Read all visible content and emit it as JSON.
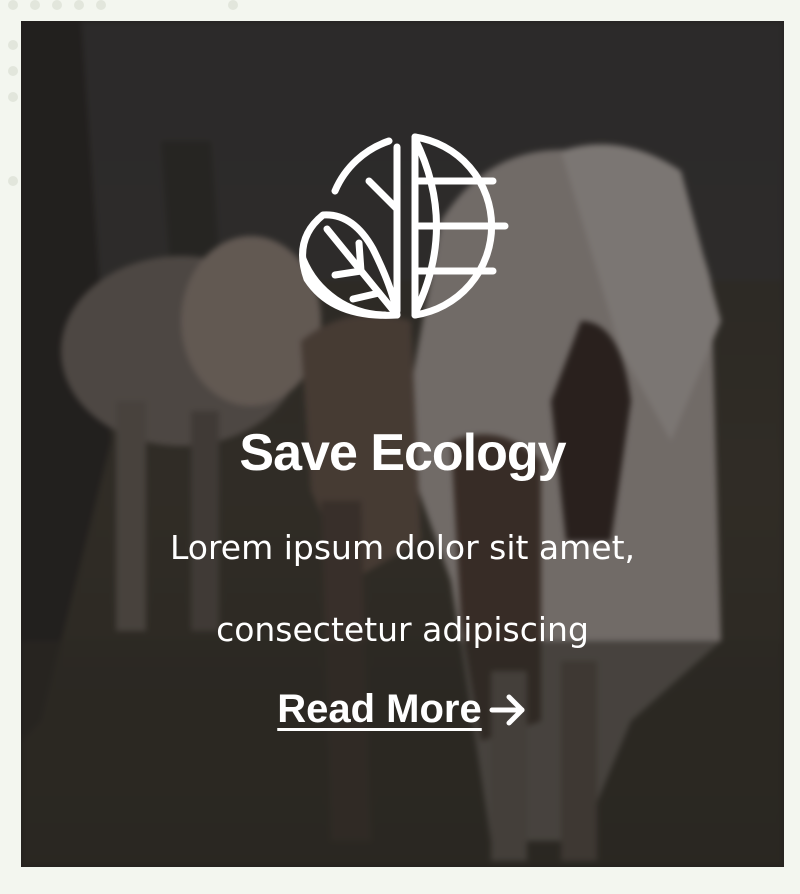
{
  "card": {
    "icon": "leaf-globe-icon",
    "title": "Save Ecology",
    "description": "Lorem ipsum dolor sit amet, consectetur adipiscing",
    "link_label": "Read More ",
    "link_icon": "arrow-right-icon",
    "background": "horses-photo",
    "colors": {
      "text": "#ffffff",
      "overlay": "#1c1818",
      "page_background": "#f3f6ef"
    }
  }
}
